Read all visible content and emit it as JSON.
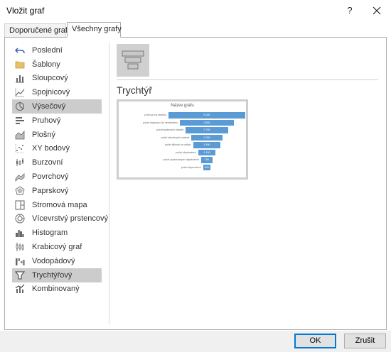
{
  "window": {
    "title": "Vložit graf",
    "help_label": "?"
  },
  "tabs": [
    {
      "label": "Doporučené grafy"
    },
    {
      "label": "Všechny grafy"
    }
  ],
  "sidebar": {
    "items": [
      {
        "label": "Poslední",
        "icon": "undo-arrow-icon"
      },
      {
        "label": "Šablony",
        "icon": "folder-icon"
      },
      {
        "label": "Sloupcový",
        "icon": "column-chart-icon"
      },
      {
        "label": "Spojnicový",
        "icon": "line-chart-icon"
      },
      {
        "label": "Výsečový",
        "icon": "pie-chart-icon",
        "selected": true
      },
      {
        "label": "Pruhový",
        "icon": "bar-chart-icon"
      },
      {
        "label": "Plošný",
        "icon": "area-chart-icon"
      },
      {
        "label": "XY bodový",
        "icon": "scatter-chart-icon"
      },
      {
        "label": "Burzovní",
        "icon": "stock-chart-icon"
      },
      {
        "label": "Povrchový",
        "icon": "surface-chart-icon"
      },
      {
        "label": "Paprskový",
        "icon": "radar-chart-icon"
      },
      {
        "label": "Stromová mapa",
        "icon": "treemap-icon"
      },
      {
        "label": "Vícevrstvý prstencový",
        "icon": "sunburst-icon"
      },
      {
        "label": "Histogram",
        "icon": "histogram-icon"
      },
      {
        "label": "Krabicový graf",
        "icon": "box-whisker-icon"
      },
      {
        "label": "Vodopádový",
        "icon": "waterfall-icon"
      },
      {
        "label": "Trychtýřový",
        "icon": "funnel-icon",
        "selected": true
      },
      {
        "label": "Kombinovaný",
        "icon": "combo-chart-icon"
      }
    ]
  },
  "main": {
    "selected_type_heading": "Trychtýř",
    "preview_title": "Název grafu"
  },
  "chart_data": {
    "type": "bar",
    "subtype": "funnel",
    "title": "Název grafu",
    "categories": [
      "příchozí na stránku",
      "počet registrací do newsletteru",
      "počet stažených ukázek",
      "počet otevřených ukázek",
      "počet kliknutí na odkaz",
      "počet objednávek",
      "počet opakovaných objednávek",
      "počet doporučení"
    ],
    "values": [
      5000,
      3500,
      2750,
      2000,
      1800,
      1150,
      750,
      500
    ],
    "value_labels": [
      "5 000",
      "3 500",
      "2 750",
      "2 000",
      "1 800",
      "1 150",
      "750",
      "500"
    ],
    "bar_color": "#5b9bd5"
  },
  "buttons": {
    "ok": "OK",
    "cancel": "Zrušit"
  }
}
